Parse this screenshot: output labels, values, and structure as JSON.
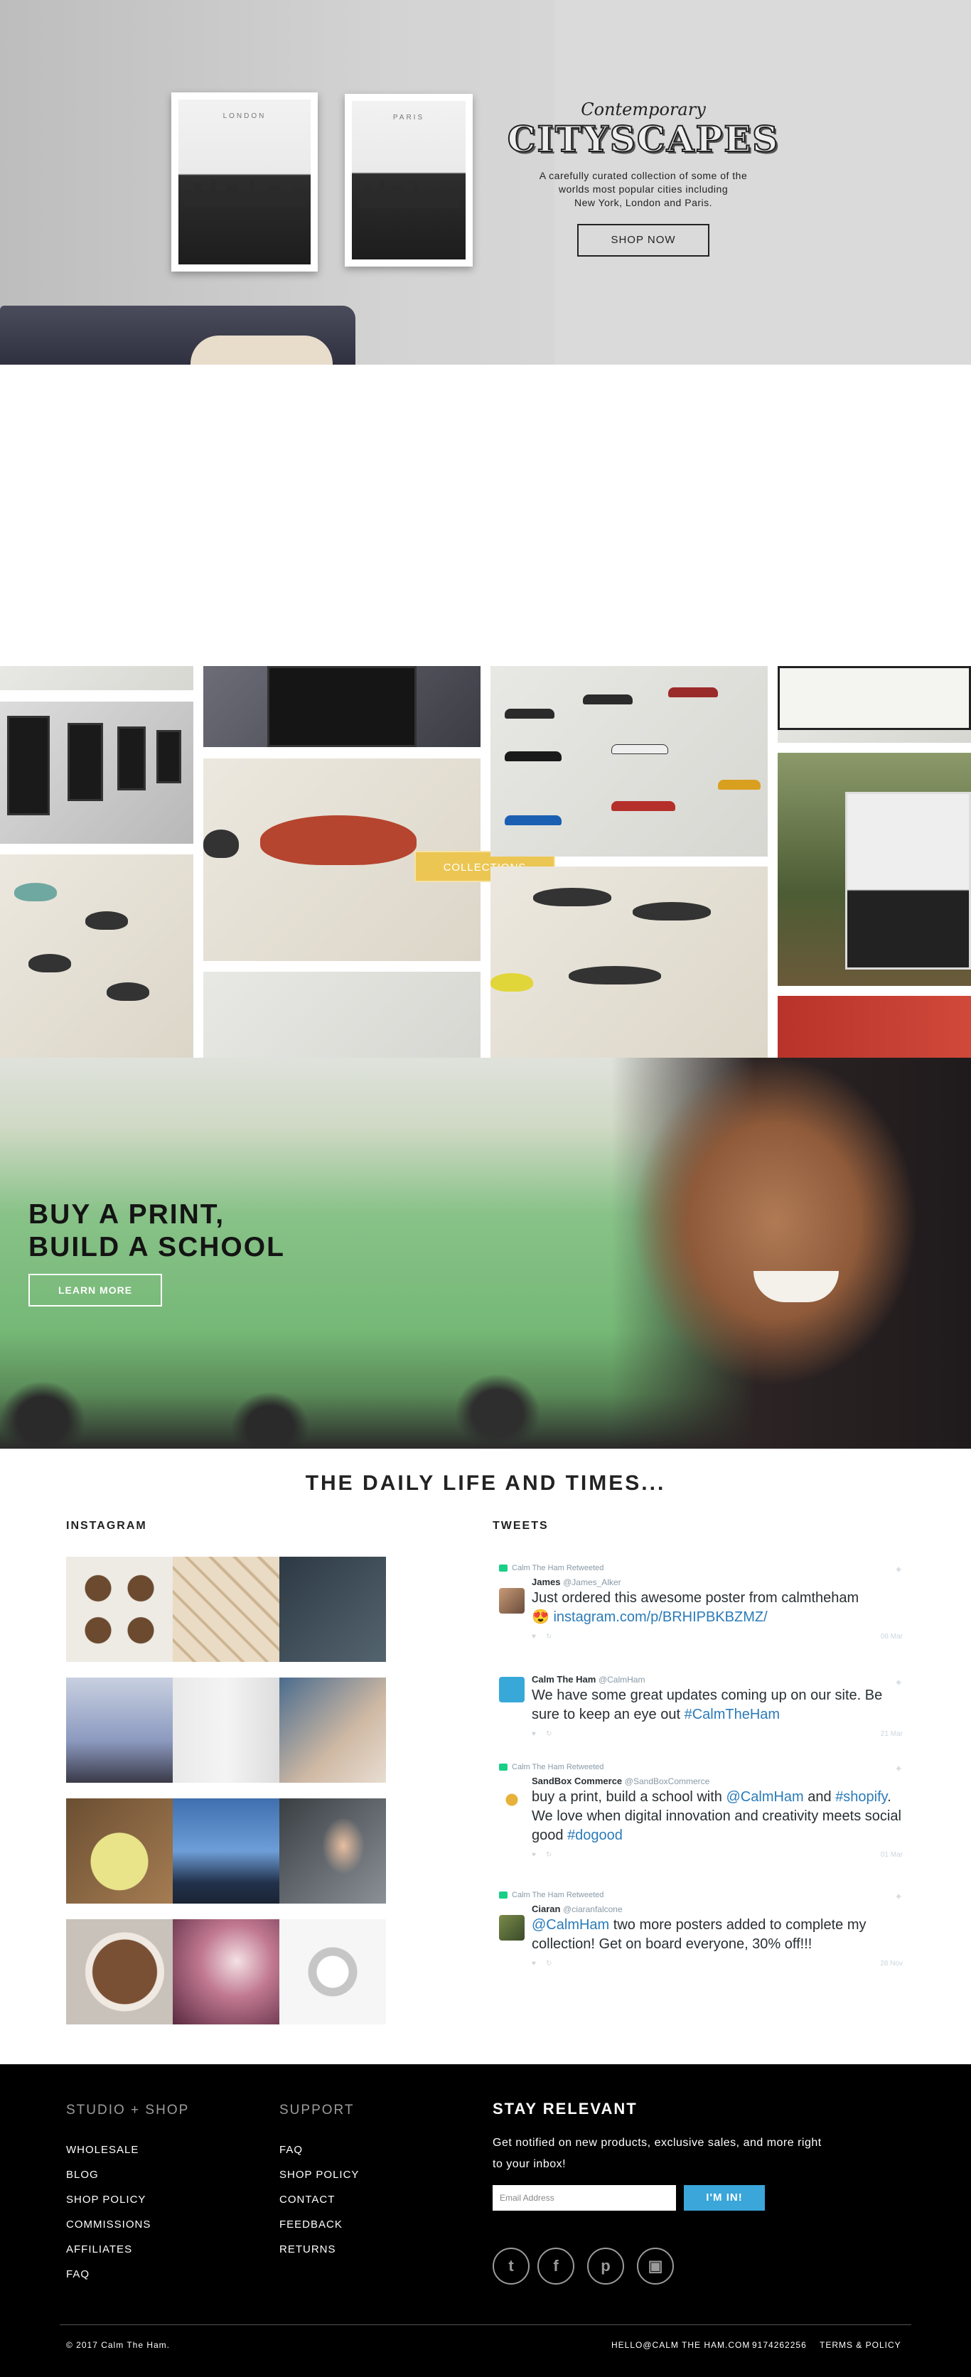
{
  "hero": {
    "kicker": "Contemporary",
    "title": "CITYSCAPES",
    "description_lines": [
      "A carefully curated collection of some of the",
      "worlds most popular cities including",
      "New York, London and Paris."
    ],
    "cta_label": "SHOP NOW",
    "frame_left_city": "LONDON",
    "frame_right_city": "PARIS"
  },
  "collage": {
    "cta_label": "COLLECTIONS"
  },
  "school": {
    "headline_line1": "BUY A PRINT,",
    "headline_line2": "BUILD A SCHOOL",
    "cta_label": "LEARN MORE"
  },
  "daily": {
    "title": "THE DAILY LIFE AND TIMES...",
    "instagram_label": "INSTAGRAM",
    "tweets_label": "TWEETS"
  },
  "tweets": [
    {
      "retweet_label": "Calm The Ham Retweeted",
      "name": "James",
      "handle": "@James_Alker",
      "text": "Just ordered this awesome poster from calmtheham",
      "link": "instagram.com/p/BRHIPBKBZMZ/",
      "emoji": "😍",
      "date": "08 Mar"
    },
    {
      "retweet_label": "",
      "name": "Calm The Ham",
      "handle": "@CalmHam",
      "text": "We have some great updates coming up on our site. Be sure to keep an eye out",
      "link": "#CalmTheHam",
      "emoji": "",
      "date": "21 Mar"
    },
    {
      "retweet_label": "Calm The Ham Retweeted",
      "name": "SandBox Commerce",
      "handle": "@SandBoxCommerce",
      "text_parts": [
        "buy a print, build a school with ",
        "@CalmHam",
        " and ",
        "#shopify",
        ". We love when digital innovation and creativity meets social good ",
        "#dogood"
      ],
      "date": "01 Mar"
    },
    {
      "retweet_label": "Calm The Ham Retweeted",
      "name": "Ciaran",
      "handle": "@ciaranfalcone",
      "link": "@CalmHam",
      "text": " two more posters added to complete my collection! Get on board everyone, 30% off!!!",
      "date": "28 Nov"
    }
  ],
  "footer": {
    "col1_heading": "STUDIO + SHOP",
    "col1_links": [
      "WHOLESALE",
      "BLOG",
      "SHOP POLICY",
      "COMMISSIONS",
      "AFFILIATES",
      "FAQ"
    ],
    "col2_heading": "SUPPORT",
    "col2_links": [
      "FAQ",
      "SHOP POLICY",
      "CONTACT",
      "FEEDBACK",
      "RETURNS"
    ],
    "stay_heading": "STAY RELEVANT",
    "stay_desc": "Get notified on new products, exclusive sales, and more right to your inbox!",
    "email_placeholder": "Email Address",
    "submit_label": "I'M IN!",
    "copyright": "© 2017 Calm The Ham.",
    "email_contact": "HELLO@CALM THE HAM.COM",
    "phone": "9174262256",
    "terms": "TERMS & POLICY"
  },
  "colors": {
    "accent_blue": "#3aa6d9",
    "collections_gold": "#ebc653",
    "twitter_link": "#2b7bb9"
  },
  "icons": [
    "twitter-icon",
    "facebook-icon",
    "pinterest-icon",
    "instagram-icon",
    "heart-icon",
    "retweet-icon",
    "twitter-bird-icon"
  ]
}
